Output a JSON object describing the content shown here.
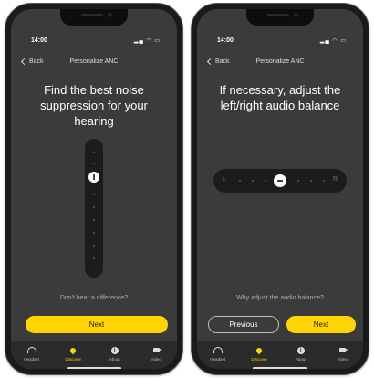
{
  "colors": {
    "accent": "#ffd400",
    "screen_bg": "#3b3b3b",
    "track_bg": "#1c1c1c"
  },
  "screens": [
    {
      "status": {
        "time": "14:00",
        "icons": "signal-wifi-battery"
      },
      "nav": {
        "back_label": "Back",
        "title": "Personalize ANC"
      },
      "headline": "Find the best noise suppression for your hearing",
      "slider": {
        "orientation": "vertical",
        "position_fraction": 0.3
      },
      "hint": "Don't hear a difference?",
      "next_label": "Next"
    },
    {
      "status": {
        "time": "14:00",
        "icons": "signal-wifi-battery"
      },
      "nav": {
        "back_label": "Back",
        "title": "Personalize ANC"
      },
      "headline": "If necessary, adjust the left/right audio balance",
      "balance": {
        "left_label": "L",
        "right_label": "R",
        "position_fraction": 0.5
      },
      "hint": "Why adjust the audio balance?",
      "previous_label": "Previous",
      "next_label": "Next"
    }
  ],
  "tabs": [
    {
      "label": "Headset",
      "icon": "headset-icon"
    },
    {
      "label": "Discover",
      "icon": "discover-icon",
      "active": true
    },
    {
      "label": "About",
      "icon": "info-icon"
    },
    {
      "label": "Video",
      "icon": "video-icon"
    }
  ]
}
